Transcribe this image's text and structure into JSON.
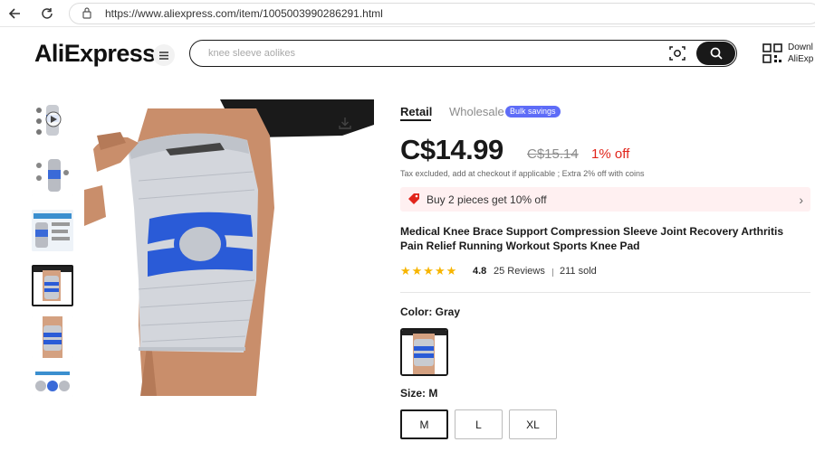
{
  "browser": {
    "url": "https://www.aliexpress.com/item/1005003990286291.html"
  },
  "header": {
    "logo": "AliExpress",
    "search_placeholder": "knee sleeve aolikes",
    "app_text_line1": "Downl",
    "app_text_line2": "AliExp"
  },
  "gallery": {
    "thumbnail_count": 6,
    "selected_index": 3
  },
  "product": {
    "tabs": {
      "retail": "Retail",
      "wholesale": "Wholesale",
      "bulk_badge": "Bulk savings"
    },
    "price": "C$14.99",
    "old_price": "C$15.14",
    "discount": "1% off",
    "tax_note": "Tax excluded, add at checkout if applicable ; Extra 2% off with coins",
    "promo": "Buy 2 pieces get 10% off",
    "title": "Medical Knee Brace Support Compression Sleeve Joint Recovery Arthritis Pain Relief Running Workout Sports Knee Pad",
    "rating": "4.8",
    "stars": "★★★★★",
    "reviews": "25 Reviews",
    "sold": "211 sold",
    "color_label": "Color: Gray",
    "size_label": "Size: M",
    "sizes": [
      "M",
      "L",
      "XL"
    ],
    "selected_size": "M"
  },
  "colors": {
    "accent_red": "#e1251b",
    "bulk_badge": "#5e6cf7",
    "promo_bg": "#fff0f1",
    "star": "#f7b500",
    "brace_blue": "#2a5bd7"
  }
}
